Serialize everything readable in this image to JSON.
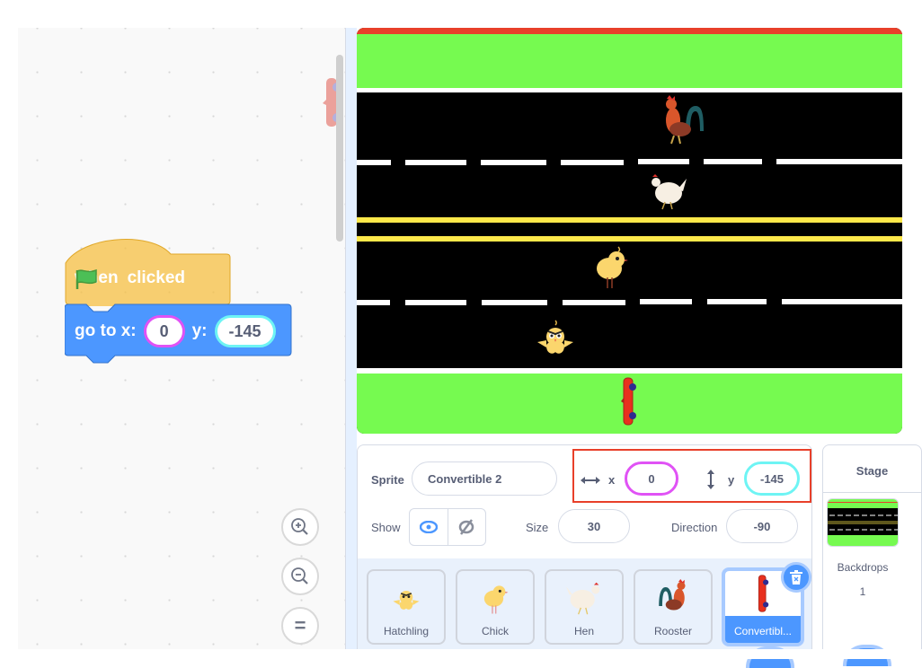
{
  "workspace": {
    "hat_block": {
      "when": "when",
      "icon": "green-flag-icon",
      "clicked": "clicked"
    },
    "motion_block": {
      "label_x": "go to x:",
      "x": "0",
      "label_y": "y:",
      "y": "-145"
    },
    "zoom_controls": {
      "zoom_in": "zoom-in-icon",
      "zoom_out": "zoom-out-icon",
      "reset": "="
    }
  },
  "stage": {
    "colors": {
      "grass": "#76fa50",
      "road": "#000000",
      "lane_white": "#ffffff",
      "lane_yellow": "#fde84a",
      "top_bar": "#e8402a"
    }
  },
  "sprite_info": {
    "sprite_label": "Sprite",
    "sprite_name": "Convertible 2",
    "x_label": "x",
    "x_value": "0",
    "y_label": "y",
    "y_value": "-145",
    "show_label": "Show",
    "size_label": "Size",
    "size_value": "30",
    "direction_label": "Direction",
    "direction_value": "-90"
  },
  "sprites": [
    {
      "name": "Hatchling",
      "selected": false
    },
    {
      "name": "Chick",
      "selected": false
    },
    {
      "name": "Hen",
      "selected": false
    },
    {
      "name": "Rooster",
      "selected": false
    },
    {
      "name": "Convertibl...",
      "selected": true
    }
  ],
  "stage_pane": {
    "title": "Stage",
    "backdrops_label": "Backdrops",
    "backdrops_count": "1"
  }
}
